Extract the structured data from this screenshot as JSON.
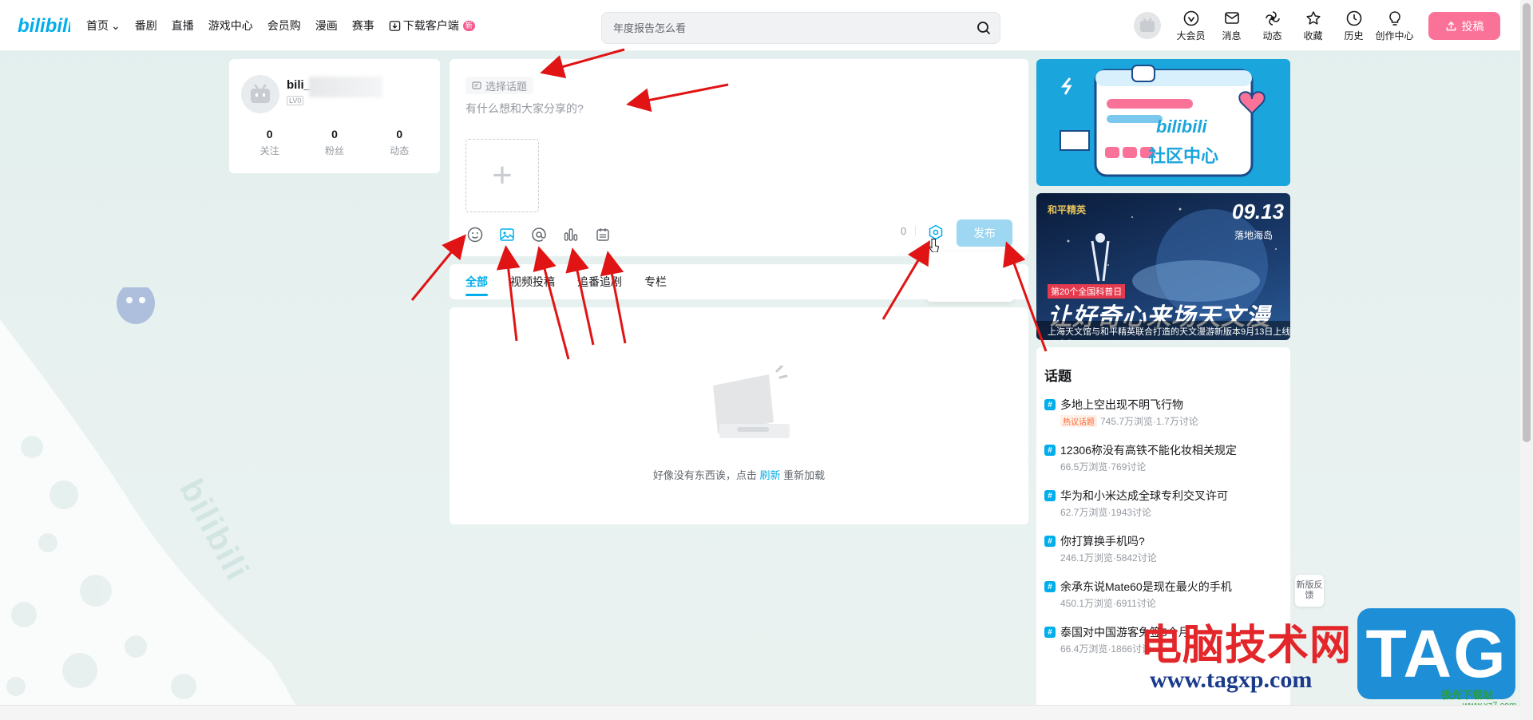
{
  "header": {
    "nav": [
      {
        "label": "首页",
        "dropdown": true
      },
      {
        "label": "番剧"
      },
      {
        "label": "直播"
      },
      {
        "label": "游戏中心"
      },
      {
        "label": "会员购"
      },
      {
        "label": "漫画"
      },
      {
        "label": "赛事"
      },
      {
        "label": "下载客户端",
        "badge": "新"
      }
    ],
    "search_placeholder": "年度报告怎么看",
    "right_icons": [
      {
        "label": "大会员",
        "icon": "vip-icon"
      },
      {
        "label": "消息",
        "icon": "message-icon"
      },
      {
        "label": "动态",
        "icon": "dynamic-icon"
      },
      {
        "label": "收藏",
        "icon": "star-icon"
      },
      {
        "label": "历史",
        "icon": "history-icon"
      },
      {
        "label": "创作中心",
        "icon": "bulb-icon"
      }
    ],
    "upload_label": "投稿"
  },
  "user": {
    "name": "bili_3",
    "level": "LV0",
    "stats": [
      {
        "num": "0",
        "label": "关注"
      },
      {
        "num": "0",
        "label": "粉丝"
      },
      {
        "num": "0",
        "label": "动态"
      }
    ]
  },
  "composer": {
    "topic_label": "选择话题",
    "placeholder": "有什么想和大家分享的?",
    "add_symbol": "+",
    "char_count": "0",
    "publish_label": "发布",
    "schedule_label": "定时发布"
  },
  "tabs": [
    {
      "label": "全部",
      "active": true
    },
    {
      "label": "视频投稿"
    },
    {
      "label": "追番追剧"
    },
    {
      "label": "专栏"
    }
  ],
  "feed": {
    "empty_text_before": "好像没有东西诶，点击",
    "empty_link": "刷新",
    "empty_text_after": "重新加载"
  },
  "banners": {
    "community": {
      "logo": "bilibili",
      "title": "社区中心"
    },
    "event": {
      "brand": "和平精英",
      "date": "09.13",
      "place": "落地海岛",
      "sub": "第20个全国科普日",
      "big": "让好奇心来场天文漫游",
      "caption": "上海天文馆与和平精英联合打造的天文漫游新版本9月13日上线"
    }
  },
  "topics": {
    "title": "话题",
    "items": [
      {
        "name": "多地上空出现不明飞行物",
        "hot": "热议话题",
        "meta": "745.7万浏览·1.7万讨论"
      },
      {
        "name": "12306称没有高铁不能化妆相关规定",
        "meta": "66.5万浏览·769讨论"
      },
      {
        "name": "华为和小米达成全球专利交叉许可",
        "meta": "62.7万浏览·1943讨论"
      },
      {
        "name": "你打算换手机吗?",
        "meta": "246.1万浏览·5842讨论"
      },
      {
        "name": "余承东说Mate60是现在最火的手机",
        "meta": "450.1万浏览·6911讨论"
      },
      {
        "name": "泰国对中国游客免签5个月",
        "meta": "66.4万浏览·1866讨论"
      }
    ]
  },
  "feedback_label": "新版反馈",
  "watermark": {
    "cn": "电脑技术网",
    "url": "www.tagxp.com",
    "tag": "TAG",
    "xz": "极光下载站",
    "xz_url": "www.xz7.com"
  },
  "colors": {
    "accent": "#00aeec",
    "upload": "#fb7299",
    "publish_disabled": "#9ed7f1",
    "arrow": "#e01414"
  }
}
